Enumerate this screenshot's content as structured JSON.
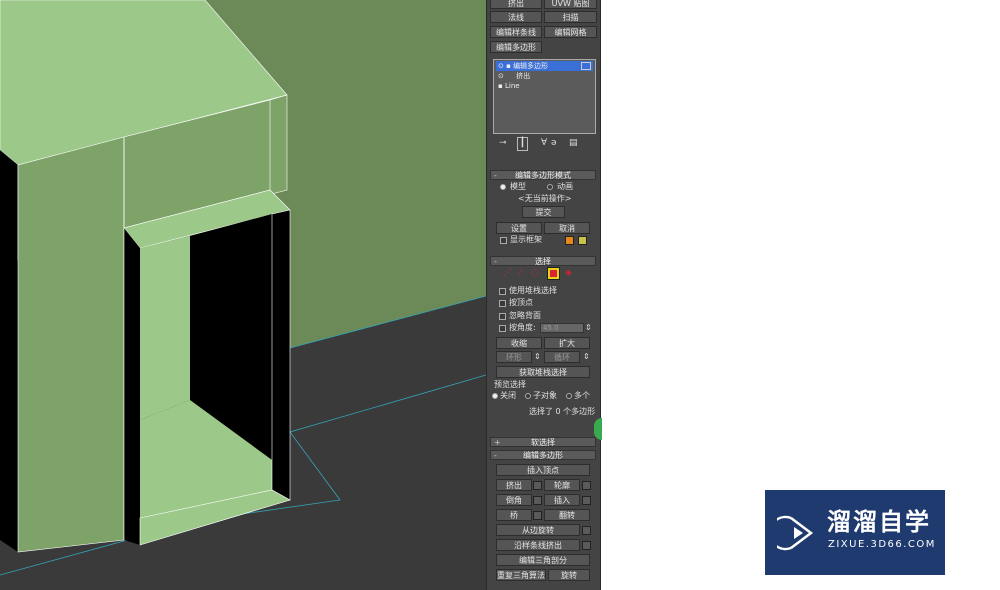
{
  "modifier_buttons": [
    "挤出",
    "UVW 贴图",
    "法线",
    "扫描",
    "编辑样条线",
    "编辑网格",
    "编辑多边形"
  ],
  "stack": {
    "items": [
      "编辑多边形",
      "挤出",
      "Line"
    ]
  },
  "edit_poly_mode": {
    "title": "编辑多边形模式",
    "radio_model": "模型",
    "radio_anim": "动画",
    "no_operation": "<无当前操作>",
    "commit": "提交",
    "settings": "设置",
    "cancel": "取消",
    "show_cage": "显示框架",
    "cage_color1": "#e8871a",
    "cage_color2": "#c9c24a"
  },
  "selection": {
    "title": "选择",
    "use_stack": "使用堆栈选择",
    "by_vertex": "按顶点",
    "ignore_backface": "忽略背面",
    "by_angle": "按角度:",
    "angle_value": "45.0",
    "shrink": "收缩",
    "grow": "扩大",
    "ring": "环形",
    "loop": "循环",
    "get_stack": "获取堆栈选择",
    "preview_title": "预览选择",
    "preview_off": "关闭",
    "preview_sub": "子对象",
    "preview_multi": "多个",
    "status": "选择了 0 个多边形",
    "active_mode_color": "#e8d21a"
  },
  "soft_selection": {
    "title": "软选择"
  },
  "edit_polygons": {
    "title": "编辑多边形",
    "insert_vertex": "插入顶点",
    "extrude": "挤出",
    "outline": "轮廓",
    "bevel": "倒角",
    "inset": "插入",
    "bridge": "桥",
    "flip": "翻转",
    "hinge": "从边旋转",
    "extrude_spline": "沿样条线挤出",
    "edit_tri": "编辑三角剖分",
    "retriangulate": "重复三角算法",
    "turn": "旋转"
  },
  "watermark": {
    "title": "溜溜自学",
    "url": "ZIXUE.3D66.COM"
  },
  "colors": {
    "wall_light": "#9cc98a",
    "wall_mid": "#7ea369",
    "wall_dark": "#6a8a57",
    "floor": "#3a3a3a",
    "wireframe": "#34a5b8"
  }
}
